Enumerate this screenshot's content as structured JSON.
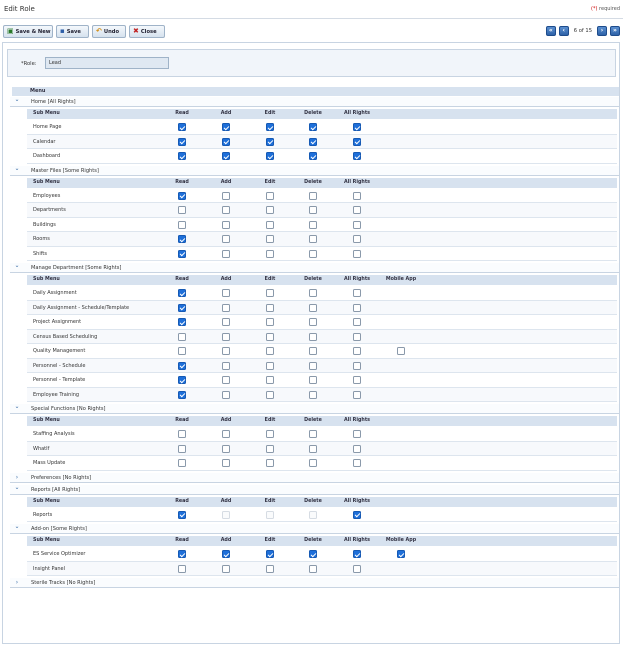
{
  "title": "Edit Role",
  "required_note": {
    "marker": "(*)",
    "text": " required"
  },
  "toolbar": {
    "save_new": "Save & New",
    "save": "Save",
    "undo": "Undo",
    "close": "Close",
    "pager_text": "6 of 15"
  },
  "role": {
    "label": "*Role:",
    "value": "Lead"
  },
  "menu_header": "Menu",
  "columns": {
    "sub_menu": "Sub Menu",
    "read": "Read",
    "add": "Add",
    "edit": "Edit",
    "delete": "Delete",
    "all_rights": "All Rights",
    "mobile_app": "Mobile App"
  },
  "sections": [
    {
      "name": "Home  [All Rights]",
      "expanded": true,
      "mobile": false,
      "rows": [
        {
          "label": "Home Page",
          "checks": [
            "on",
            "on",
            "on",
            "on",
            "on"
          ]
        },
        {
          "label": "Calendar",
          "checks": [
            "on",
            "on",
            "on",
            "on",
            "on"
          ]
        },
        {
          "label": "Dashboard",
          "checks": [
            "on",
            "on",
            "on",
            "on",
            "on"
          ]
        }
      ]
    },
    {
      "name": "Master Files  [Some Rights]",
      "expanded": true,
      "mobile": false,
      "rows": [
        {
          "label": "Employees",
          "checks": [
            "on",
            "off",
            "off",
            "off",
            "off"
          ]
        },
        {
          "label": "Departments",
          "checks": [
            "off",
            "off",
            "off",
            "off",
            "off"
          ]
        },
        {
          "label": "Buildings",
          "checks": [
            "off",
            "off",
            "off",
            "off",
            "off"
          ]
        },
        {
          "label": "Rooms",
          "checks": [
            "on",
            "off",
            "off",
            "off",
            "off"
          ]
        },
        {
          "label": "Shifts",
          "checks": [
            "on",
            "off",
            "off",
            "off",
            "off"
          ]
        }
      ]
    },
    {
      "name": "Manage Department  [Some Rights]",
      "expanded": true,
      "mobile": true,
      "rows": [
        {
          "label": "Daily Assignment",
          "checks": [
            "on",
            "off",
            "off",
            "off",
            "off"
          ]
        },
        {
          "label": "Daily Assignment - Schedule/Template",
          "checks": [
            "on",
            "off",
            "off",
            "off",
            "off"
          ]
        },
        {
          "label": "Project Assignment",
          "checks": [
            "on",
            "off",
            "off",
            "off",
            "off"
          ]
        },
        {
          "label": "Census Based Scheduling",
          "checks": [
            "off",
            "off",
            "off",
            "off",
            "off"
          ]
        },
        {
          "label": "Quality Management",
          "checks": [
            "off",
            "off",
            "off",
            "off",
            "off",
            "off"
          ]
        },
        {
          "label": "Personnel - Schedule",
          "checks": [
            "on",
            "off",
            "off",
            "off",
            "off"
          ]
        },
        {
          "label": "Personnel - Template",
          "checks": [
            "on",
            "off",
            "off",
            "off",
            "off"
          ]
        },
        {
          "label": "Employee Training",
          "checks": [
            "on",
            "off",
            "off",
            "off",
            "off"
          ]
        }
      ]
    },
    {
      "name": "Special Functions  [No Rights]",
      "expanded": true,
      "mobile": false,
      "rows": [
        {
          "label": "Staffing Analysis",
          "checks": [
            "off",
            "off",
            "off",
            "off",
            "off"
          ]
        },
        {
          "label": "WhatIf",
          "checks": [
            "off",
            "off",
            "off",
            "off",
            "off"
          ]
        },
        {
          "label": "Mass Update",
          "checks": [
            "off",
            "off",
            "off",
            "off",
            "off"
          ]
        }
      ]
    },
    {
      "name": "Preferences  [No Rights]",
      "expanded": false,
      "mobile": false,
      "rows": []
    },
    {
      "name": "Reports  [All Rights]",
      "expanded": true,
      "mobile": false,
      "rows": [
        {
          "label": "Reports",
          "checks": [
            "on",
            "dis",
            "dis",
            "dis",
            "on"
          ]
        }
      ]
    },
    {
      "name": "Add-on  [Some Rights]",
      "expanded": true,
      "mobile": true,
      "rows": [
        {
          "label": "ES Service Optimizer",
          "checks": [
            "on",
            "on",
            "on",
            "on",
            "on",
            "on"
          ]
        },
        {
          "label": "Insight Panel",
          "checks": [
            "off",
            "off",
            "off",
            "off",
            "off"
          ]
        }
      ]
    },
    {
      "name": "Sterile Tracks  [No Rights]",
      "expanded": false,
      "mobile": false,
      "rows": []
    }
  ],
  "colors": {
    "accent": "#1e6fd9",
    "header_bg": "#d7e2ef",
    "chevron": "#3a6ea8"
  }
}
